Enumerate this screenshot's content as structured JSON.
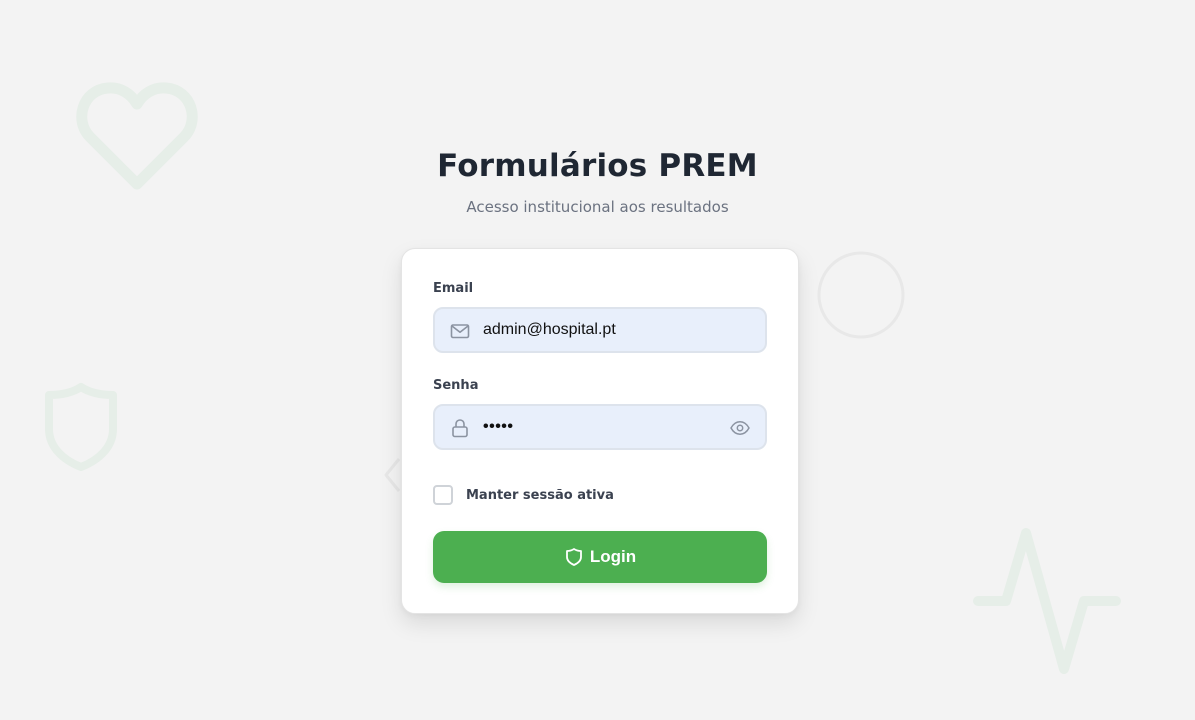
{
  "header": {
    "title": "Formulários PREM",
    "subtitle": "Acesso institucional aos resultados"
  },
  "form": {
    "email": {
      "label": "Email",
      "value": "admin@hospital.pt",
      "icon": "mail-icon"
    },
    "password": {
      "label": "Senha",
      "value": "•••••",
      "icon": "lock-icon",
      "toggle_icon": "eye-icon"
    },
    "remember": {
      "label": "Manter sessão ativa",
      "checked": false
    },
    "submit": {
      "label": "Login",
      "icon": "shield-icon"
    }
  },
  "colors": {
    "background": "#f3f3f3",
    "primary": "#4caf50",
    "input_background": "#e8effb",
    "title": "#1f2733",
    "decorative": "#e7efe9"
  },
  "decorations": [
    "heart-icon",
    "circle-shape",
    "shield-icon",
    "chevron-left-icon",
    "pulse-icon"
  ]
}
